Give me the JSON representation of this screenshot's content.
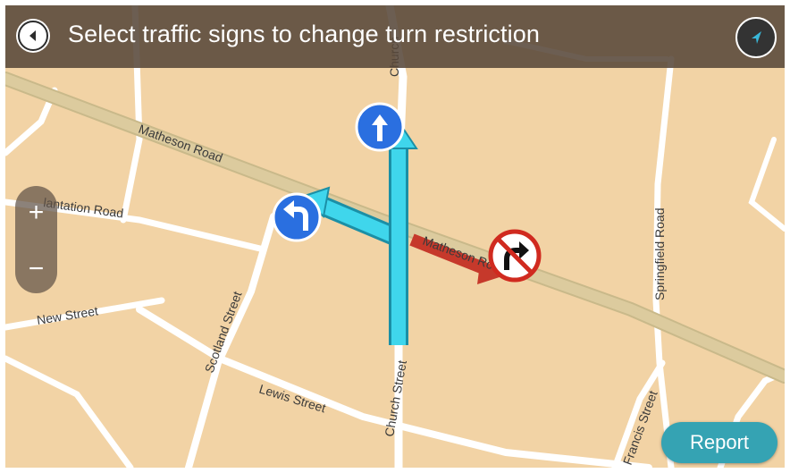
{
  "header": {
    "title": "Select traffic signs to change turn restriction",
    "back_icon": "back-arrow-icon",
    "compass_icon": "compass-arrow-icon"
  },
  "map": {
    "streets": {
      "matheson_road_top": "Matheson Road",
      "matheson_road_right": "Matheson Road",
      "plantation_road": "lantation Road",
      "new_street": "New Street",
      "scotland_street": "Scotland Street",
      "lewis_street": "Lewis Street",
      "church_street_bottom": "Church Street",
      "church_street_top": "Church",
      "springfield_road": "Springfield Road",
      "francis_street": "Francis Street"
    },
    "signs": {
      "straight_icon": "straight-arrow-sign-icon",
      "left_turn_icon": "left-turn-sign-icon",
      "no_right_turn_icon": "no-right-turn-sign-icon"
    },
    "colors": {
      "land": "#f2d3a5",
      "main_road": "#d9c99a",
      "route": "#3fd6ec",
      "restricted": "#c6392b",
      "sign_blue": "#2a6fe0"
    }
  },
  "zoom": {
    "in_label": "+",
    "out_label": "−"
  },
  "actions": {
    "report_label": "Report"
  }
}
